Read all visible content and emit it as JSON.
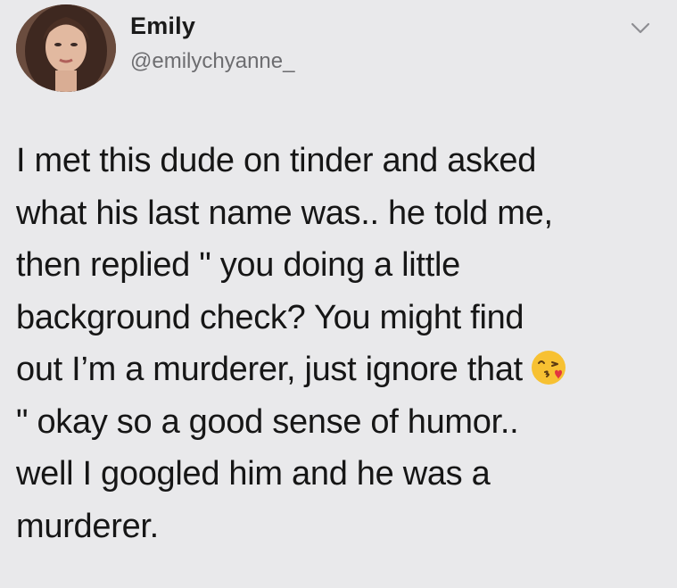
{
  "user": {
    "display_name": "Emily",
    "handle": "@emilychyanne_"
  },
  "icons": {
    "menu": "chevron-down-icon",
    "emoji": "face-blowing-kiss-emoji"
  },
  "tweet": {
    "lines": [
      "I met this dude on tinder and asked",
      "what his last name was.. he told me,",
      "then replied \" you doing a little",
      "background check? You might find",
      "out I’m a murderer, just ignore that",
      "\" okay so a good sense of humor..",
      "well I googled him and he was a",
      "murderer."
    ]
  },
  "colors": {
    "background": "#e9e9eb",
    "text": "#161616",
    "handle": "#6d6d70",
    "emoji": "#f7c132"
  }
}
